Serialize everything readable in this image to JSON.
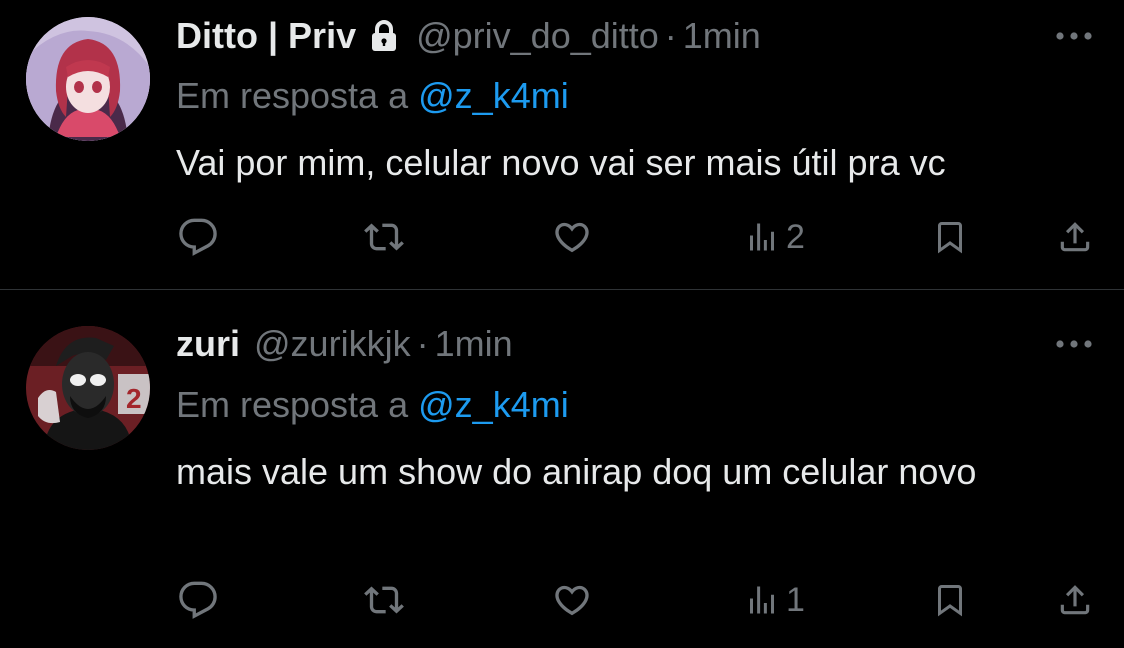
{
  "theme": {
    "background": "#000000",
    "text_primary": "#e7e9ea",
    "text_secondary": "#71767b",
    "accent": "#1d9bf0",
    "divider": "#2f3336"
  },
  "tweets": [
    {
      "display_name": "Ditto | Priv",
      "protected": true,
      "handle": "@priv_do_ditto",
      "separator": "·",
      "time": "1min",
      "reply_prefix": "Em resposta a",
      "reply_mention": "@z_k4mi",
      "text": "Vai por mim, celular novo vai ser mais útil pra vc",
      "views": "2",
      "icons": [
        "avatar",
        "lock-icon",
        "more-icon",
        "reply-icon",
        "retweet-icon",
        "like-icon",
        "views-icon",
        "bookmark-icon",
        "share-icon"
      ]
    },
    {
      "display_name": "zuri",
      "protected": false,
      "handle": "@zurikkjk",
      "separator": "·",
      "time": "1min",
      "reply_prefix": "Em resposta a",
      "reply_mention": "@z_k4mi",
      "text": "mais vale um show do anirap doq um celular novo",
      "views": "1",
      "icons": [
        "avatar",
        "more-icon",
        "reply-icon",
        "retweet-icon",
        "like-icon",
        "views-icon",
        "bookmark-icon",
        "share-icon"
      ]
    }
  ]
}
